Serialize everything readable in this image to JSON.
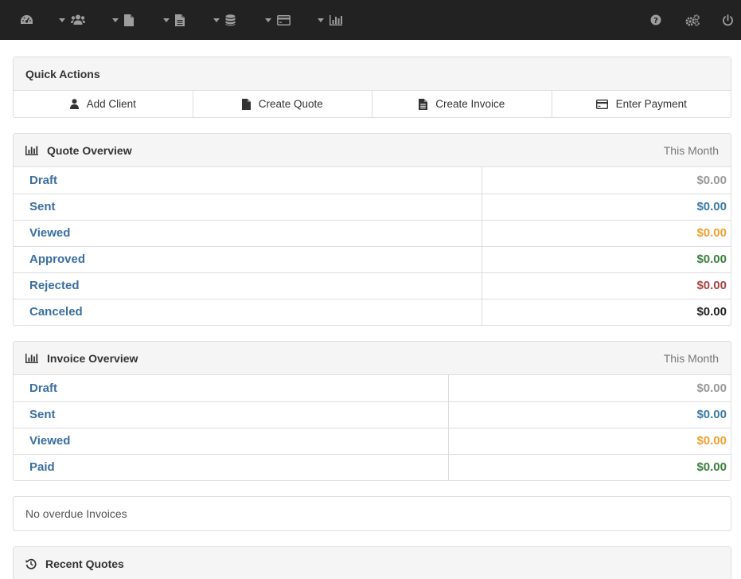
{
  "navbar": {
    "left_items": [
      {
        "icon": "dashboard-icon",
        "has_caret": false
      },
      {
        "icon": "clients-icon",
        "has_caret": true
      },
      {
        "icon": "quote-file-icon",
        "has_caret": true
      },
      {
        "icon": "invoice-file-icon",
        "has_caret": true
      },
      {
        "icon": "database-icon",
        "has_caret": true
      },
      {
        "icon": "credit-card-icon",
        "has_caret": true
      },
      {
        "icon": "bar-chart-icon",
        "has_caret": true
      }
    ],
    "right_items": [
      "help-icon",
      "settings-icon",
      "power-icon"
    ]
  },
  "quick_actions": {
    "title": "Quick Actions",
    "buttons": [
      {
        "label": "Add Client",
        "icon": "user-icon"
      },
      {
        "label": "Create Quote",
        "icon": "file-icon"
      },
      {
        "label": "Create Invoice",
        "icon": "file-text-icon"
      },
      {
        "label": "Enter Payment",
        "icon": "credit-card-icon"
      }
    ]
  },
  "quote_overview": {
    "title": "Quote Overview",
    "period": "This Month",
    "rows": [
      {
        "label": "Draft",
        "value": "$0.00",
        "color": "#999999"
      },
      {
        "label": "Sent",
        "value": "$0.00",
        "color": "#3a7ca5"
      },
      {
        "label": "Viewed",
        "value": "$0.00",
        "color": "#f0a030"
      },
      {
        "label": "Approved",
        "value": "$0.00",
        "color": "#3d7f3d"
      },
      {
        "label": "Rejected",
        "value": "$0.00",
        "color": "#a94442"
      },
      {
        "label": "Canceled",
        "value": "$0.00",
        "color": "#222222"
      }
    ]
  },
  "invoice_overview": {
    "title": "Invoice Overview",
    "period": "This Month",
    "rows": [
      {
        "label": "Draft",
        "value": "$0.00",
        "color": "#999999"
      },
      {
        "label": "Sent",
        "value": "$0.00",
        "color": "#3a7ca5"
      },
      {
        "label": "Viewed",
        "value": "$0.00",
        "color": "#f0a030"
      },
      {
        "label": "Paid",
        "value": "$0.00",
        "color": "#3d7f3d"
      }
    ]
  },
  "overdue": {
    "text": "No overdue Invoices"
  },
  "recent_quotes": {
    "title": "Recent Quotes",
    "icon": "history-icon"
  }
}
